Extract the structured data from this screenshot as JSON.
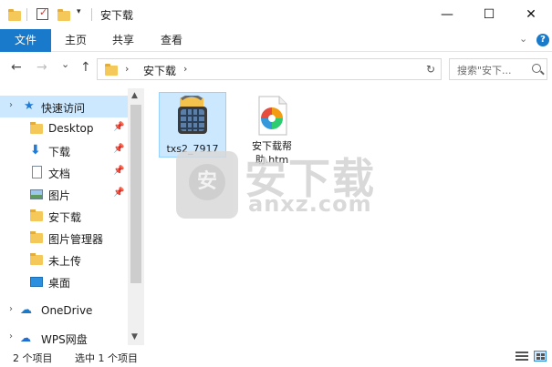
{
  "window": {
    "title": "安下载",
    "minimize": "—",
    "maximize": "☐",
    "close": "✕"
  },
  "ribbon": {
    "tabs": [
      "文件",
      "主页",
      "共享",
      "查看"
    ],
    "collapse": "⌄",
    "help": "?"
  },
  "nav": {
    "back": "←",
    "forward": "→",
    "recent": "⌄",
    "up": "↑",
    "path": "安下载",
    "refresh": "↻",
    "search_placeholder": "搜索\"安下..."
  },
  "sidebar": {
    "items": [
      {
        "label": "快速访问",
        "icon": "star-icon"
      },
      {
        "label": "Desktop",
        "icon": "folder-icon"
      },
      {
        "label": "下载",
        "icon": "download-icon"
      },
      {
        "label": "文档",
        "icon": "document-icon"
      },
      {
        "label": "图片",
        "icon": "pictures-icon"
      },
      {
        "label": "安下载",
        "icon": "folder-icon"
      },
      {
        "label": "图片管理器",
        "icon": "folder-icon"
      },
      {
        "label": "未上传",
        "icon": "folder-icon"
      },
      {
        "label": "桌面",
        "icon": "desktop-icon"
      },
      {
        "label": "OneDrive",
        "icon": "onedrive-icon"
      },
      {
        "label": "WPS网盘",
        "icon": "wps-cloud-icon"
      }
    ]
  },
  "files": [
    {
      "name": "txs2_7917",
      "icon": "archive-basket-icon"
    },
    {
      "name": "安下载帮助.htm",
      "icon": "colorful-browser-icon"
    }
  ],
  "watermark": {
    "big": "安下载",
    "small": "anxz.com"
  },
  "status": {
    "count": "2 个项目",
    "selected": "选中 1 个项目"
  }
}
